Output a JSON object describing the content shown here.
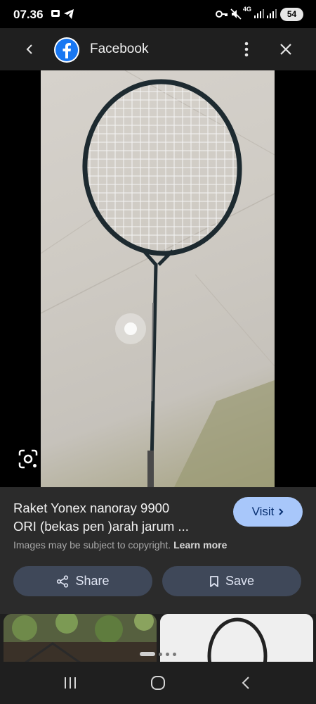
{
  "status_bar": {
    "time": "07.36",
    "network": "4G",
    "battery": "54"
  },
  "header": {
    "source_name": "Facebook",
    "icons": [
      "back-arrow-icon",
      "facebook-logo-icon",
      "more-vert-icon",
      "close-icon"
    ]
  },
  "result": {
    "title_line1": "Raket Yonex nanoray 9900",
    "title_line2": "ORI (bekas pen )arah jarum ...",
    "visit_label": "Visit",
    "copyright_text": "Images may be subject to copyright.",
    "learn_more": "Learn more",
    "share_label": "Share",
    "save_label": "Save"
  },
  "pager": {
    "count": 4,
    "active_index": 0
  },
  "colors": {
    "background": "#1f1f1f",
    "panel": "#2b2b2b",
    "visit_button": "#a8c7fa",
    "action_button": "#3f4859",
    "facebook_blue": "#1877f2"
  }
}
